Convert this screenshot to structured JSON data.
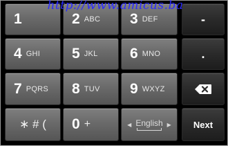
{
  "watermark": "http://www.amicus.ba",
  "keys": {
    "k1": {
      "digit": "1",
      "letters": ""
    },
    "k2": {
      "digit": "2",
      "letters": "ABC"
    },
    "k3": {
      "digit": "3",
      "letters": "DEF"
    },
    "k4": {
      "digit": "4",
      "letters": "GHI"
    },
    "k5": {
      "digit": "5",
      "letters": "JKL"
    },
    "k6": {
      "digit": "6",
      "letters": "MNO"
    },
    "k7": {
      "digit": "7",
      "letters": "PQRS"
    },
    "k8": {
      "digit": "8",
      "letters": "TUV"
    },
    "k9": {
      "digit": "9",
      "letters": "WXYZ"
    },
    "k0": {
      "digit": "0",
      "letters": "+"
    }
  },
  "symbols_key": "∗ # (",
  "minus_key": "-",
  "period_key": ".",
  "language_key": {
    "label": "English"
  },
  "next_key": "Next",
  "colors": {
    "light_key": "#6a6a6a",
    "dark_key": "#2a2a2a",
    "background": "#000000",
    "watermark": "#2b2bff"
  },
  "icons": {
    "backspace": "backspace-icon",
    "lang_left": "chevron-left-icon",
    "lang_right": "chevron-right-icon"
  }
}
